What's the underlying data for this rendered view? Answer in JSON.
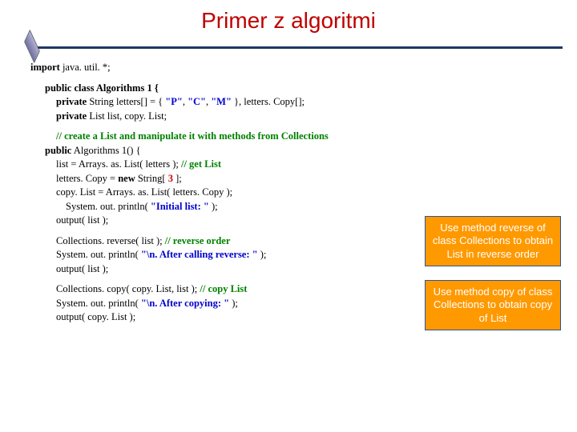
{
  "title": "Primer z algoritmi",
  "code": {
    "import_kw": "import",
    "import_rest": " java. util. *;",
    "class_sig": "public class Algorithms 1 {",
    "field1_kw": "private",
    "field1_rest": " String letters[] = { ",
    "str_P": "\"P\"",
    "str_C": "\"C\"",
    "str_M": "\"M\"",
    "field1_tail": " }, letters. Copy[];",
    "field2_kw": "private",
    "field2_rest": " List list, copy. List;",
    "comment1": "// create a List and manipulate it with methods from Collections",
    "ctor_kw": "public",
    "ctor_rest": " Algorithms 1()      {",
    "line_list": "list = Arrays. as. List( letters );    ",
    "comment_getlist": "// get List",
    "line_copy_a": "letters. Copy = ",
    "new_kw": "new",
    "line_copy_b": " String[ ",
    "num_3": "3",
    "line_copy_c": " ];",
    "line_copylist": "copy. List = Arrays. as. List( letters. Copy );",
    "print1_a": "System. out. println( ",
    "str_initial": "\"Initial list: \"",
    "print1_b": " );",
    "out1": "output( list );",
    "rev_a": "Collections. reverse( list );       ",
    "comment_rev": "// reverse order",
    "print2_a": "System. out. println( ",
    "str_after_rev": "\"\\n. After calling reverse: \"",
    "print2_b": " );",
    "out2": "output( list );",
    "copy_a": "Collections. copy( copy. List, list );  ",
    "comment_copy": "// copy List",
    "print3_a": "System. out. println( ",
    "str_after_copy": "\"\\n. After copying: \"",
    "print3_b": " );",
    "out3": "output( copy. List );"
  },
  "callouts": {
    "c1": "Use method reverse of class Collections to obtain List in reverse order",
    "c2": "Use method copy of class Collections to obtain copy of List"
  }
}
